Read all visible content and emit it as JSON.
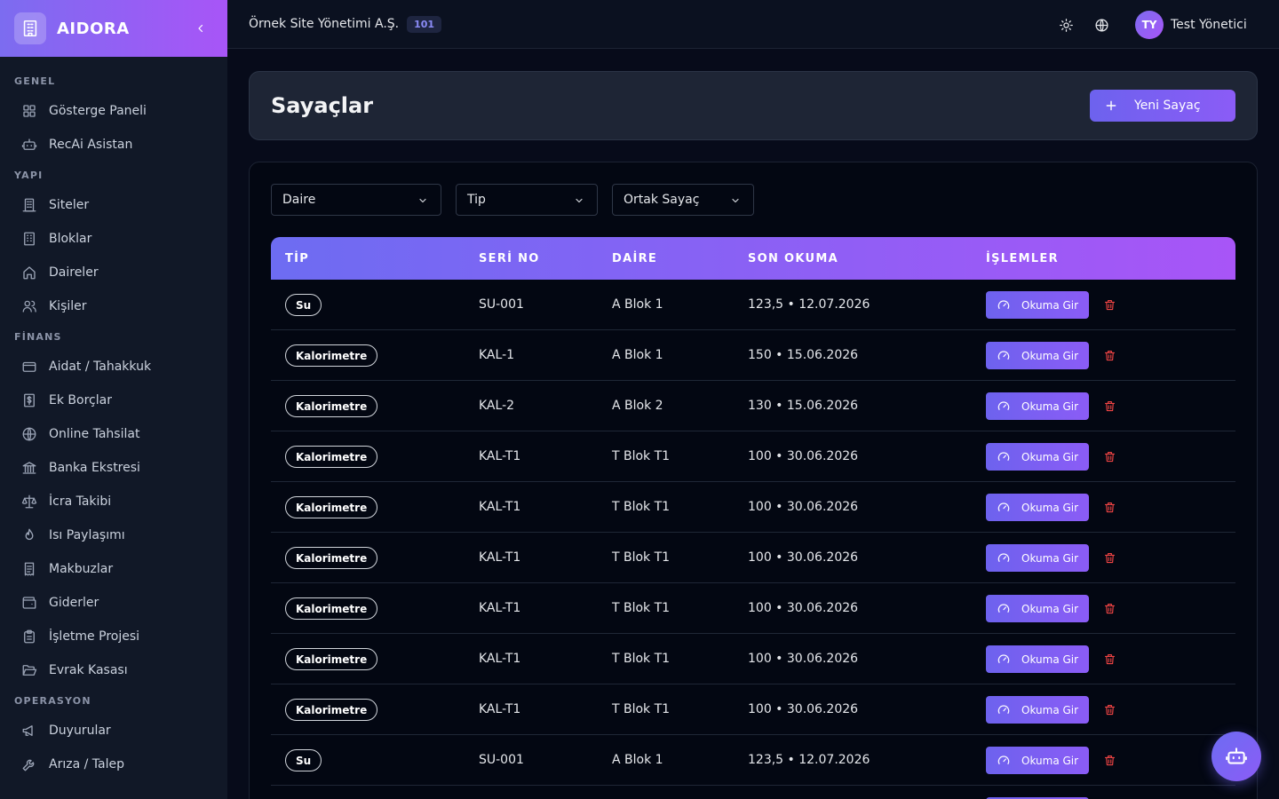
{
  "brand": {
    "name": "AIDORA"
  },
  "sidebar": {
    "sections": [
      {
        "title": "GENEL",
        "items": [
          {
            "label": "Gösterge Paneli",
            "icon": "dashboard-icon"
          },
          {
            "label": "RecAi Asistan",
            "icon": "bot-icon"
          }
        ]
      },
      {
        "title": "YAPI",
        "items": [
          {
            "label": "Siteler",
            "icon": "building-icon"
          },
          {
            "label": "Bloklar",
            "icon": "building-blocks-icon"
          },
          {
            "label": "Daireler",
            "icon": "home-icon"
          },
          {
            "label": "Kişiler",
            "icon": "users-icon"
          }
        ]
      },
      {
        "title": "FİNANS",
        "items": [
          {
            "label": "Aidat / Tahakkuk",
            "icon": "credit-card-icon"
          },
          {
            "label": "Ek Borçlar",
            "icon": "receipt-dollar-icon"
          },
          {
            "label": "Online Tahsilat",
            "icon": "globe-icon"
          },
          {
            "label": "Banka Ekstresi",
            "icon": "bank-icon"
          },
          {
            "label": "İcra Takibi",
            "icon": "scale-icon"
          },
          {
            "label": "Isı Paylaşımı",
            "icon": "flame-icon"
          },
          {
            "label": "Makbuzlar",
            "icon": "receipt-icon"
          },
          {
            "label": "Giderler",
            "icon": "wallet-icon"
          },
          {
            "label": "İşletme Projesi",
            "icon": "clipboard-icon"
          },
          {
            "label": "Evrak Kasası",
            "icon": "folder-open-icon"
          }
        ]
      },
      {
        "title": "OPERASYON",
        "items": [
          {
            "label": "Duyurular",
            "icon": "megaphone-icon"
          },
          {
            "label": "Arıza / Talep",
            "icon": "wrench-icon"
          }
        ]
      }
    ]
  },
  "topbar": {
    "org_name": "Örnek Site Yönetimi A.Ş.",
    "org_badge": "101",
    "user_initials": "TY",
    "user_name": "Test Yönetici"
  },
  "page": {
    "title": "Sayaçlar",
    "new_button": "Yeni Sayaç"
  },
  "filters": [
    {
      "label": "Daire"
    },
    {
      "label": "Tip"
    },
    {
      "label": "Ortak Sayaç"
    }
  ],
  "table": {
    "columns": [
      "TİP",
      "SERİ NO",
      "DAİRE",
      "SON OKUMA",
      "İŞLEMLER"
    ],
    "action_label": "Okuma Gir",
    "rows": [
      {
        "type": "Su",
        "serial": "SU-001",
        "unit": "A Blok 1",
        "last_reading": "123,5 • 12.07.2026"
      },
      {
        "type": "Kalorimetre",
        "serial": "KAL-1",
        "unit": "A Blok 1",
        "last_reading": "150 • 15.06.2026"
      },
      {
        "type": "Kalorimetre",
        "serial": "KAL-2",
        "unit": "A Blok 2",
        "last_reading": "130 • 15.06.2026"
      },
      {
        "type": "Kalorimetre",
        "serial": "KAL-T1",
        "unit": "T Blok T1",
        "last_reading": "100 • 30.06.2026"
      },
      {
        "type": "Kalorimetre",
        "serial": "KAL-T1",
        "unit": "T Blok T1",
        "last_reading": "100 • 30.06.2026"
      },
      {
        "type": "Kalorimetre",
        "serial": "KAL-T1",
        "unit": "T Blok T1",
        "last_reading": "100 • 30.06.2026"
      },
      {
        "type": "Kalorimetre",
        "serial": "KAL-T1",
        "unit": "T Blok T1",
        "last_reading": "100 • 30.06.2026"
      },
      {
        "type": "Kalorimetre",
        "serial": "KAL-T1",
        "unit": "T Blok T1",
        "last_reading": "100 • 30.06.2026"
      },
      {
        "type": "Kalorimetre",
        "serial": "KAL-T1",
        "unit": "T Blok T1",
        "last_reading": "100 • 30.06.2026"
      },
      {
        "type": "Su",
        "serial": "SU-001",
        "unit": "A Blok 1",
        "last_reading": "123,5 • 12.07.2026"
      },
      {
        "type": "",
        "serial": "",
        "unit": "",
        "last_reading": ""
      }
    ]
  },
  "colors": {
    "accent_start": "#6d62ee",
    "accent_end": "#a855f7",
    "delete": "#ef4444"
  }
}
